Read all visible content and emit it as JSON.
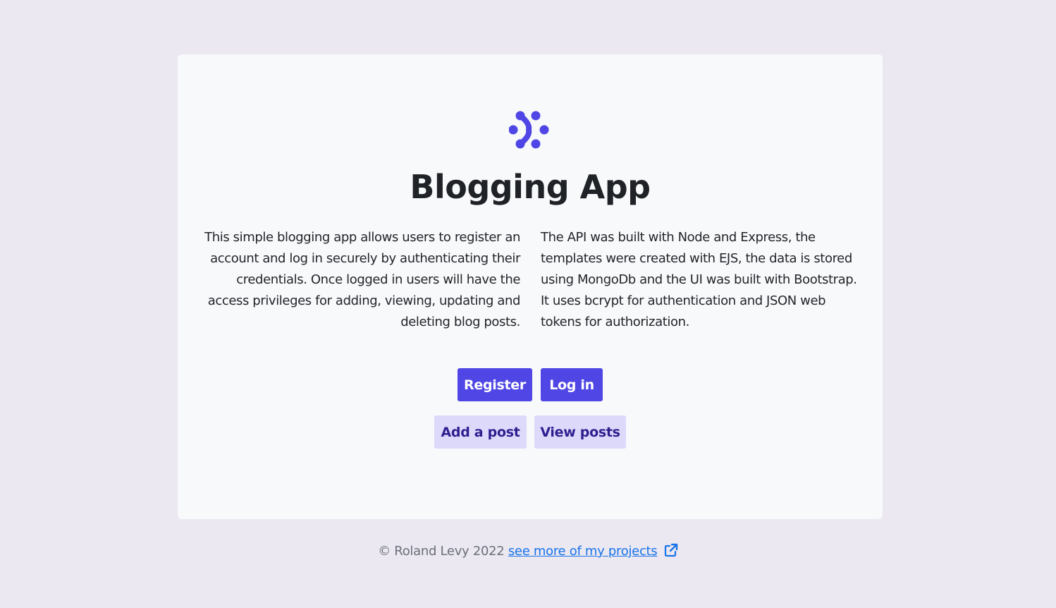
{
  "app": {
    "title": "Blogging App",
    "logo_icon": "nodes-chevron-icon",
    "brand_color": "#4f46e5"
  },
  "description": {
    "left": "This simple blogging app allows users to register an account and log in securely by authenticating their credentials. Once logged in users will have the access privileges for adding, viewing, updating and deleting blog posts.",
    "right": "The API was built with Node and Express, the templates were created with EJS, the data is stored using MongoDb and the UI was built with Bootstrap. It uses bcrypt for authentication and JSON web tokens for authorization."
  },
  "buttons": {
    "register": "Register",
    "login": "Log in",
    "add_post": "Add a post",
    "view_posts": "View posts"
  },
  "footer": {
    "copyright": "© Roland Levy 2022",
    "link_text": "see more of my projects",
    "link_icon": "external-link-icon",
    "link_color": "#1a73e8"
  }
}
